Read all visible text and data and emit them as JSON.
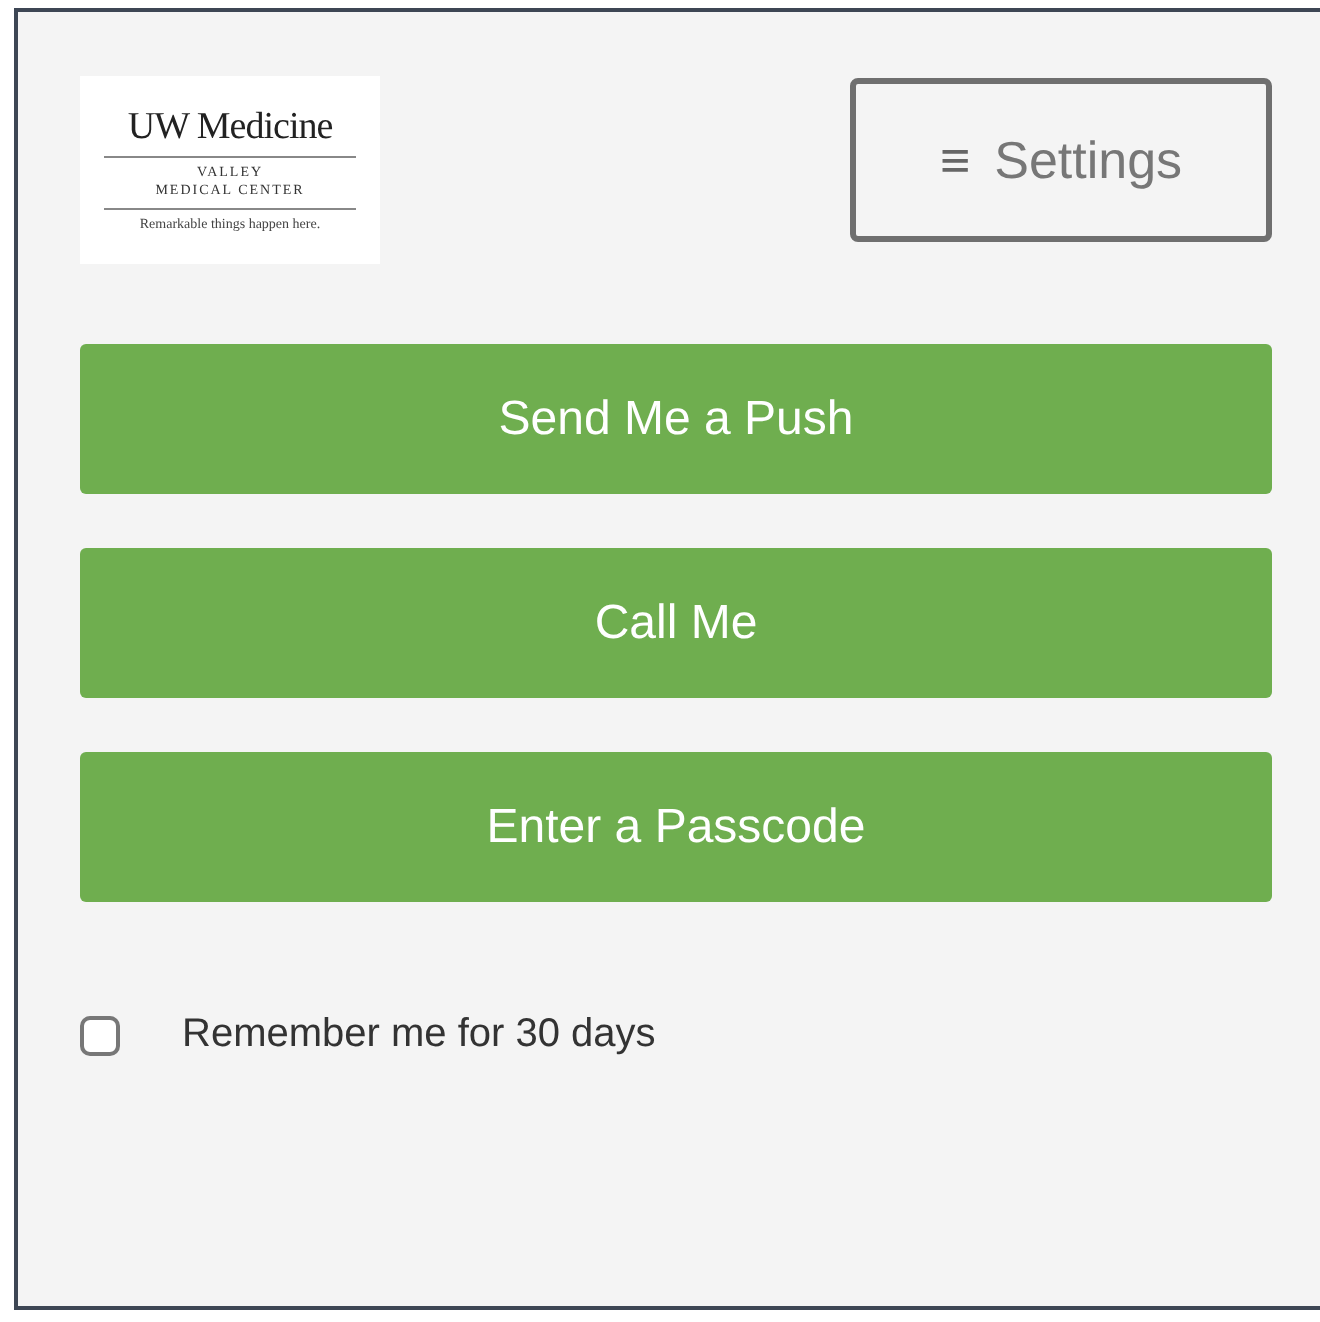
{
  "logo": {
    "title": "UW Medicine",
    "subtitle_lines": [
      "VALLEY",
      "MEDICAL CENTER"
    ],
    "tagline": "Remarkable things happen here."
  },
  "settings_button": {
    "icon": "≡",
    "label": "Settings"
  },
  "actions": [
    {
      "label": "Send Me a Push"
    },
    {
      "label": "Call Me"
    },
    {
      "label": "Enter a Passcode"
    }
  ],
  "remember": {
    "label": "Remember me for 30 days",
    "checked": false
  }
}
